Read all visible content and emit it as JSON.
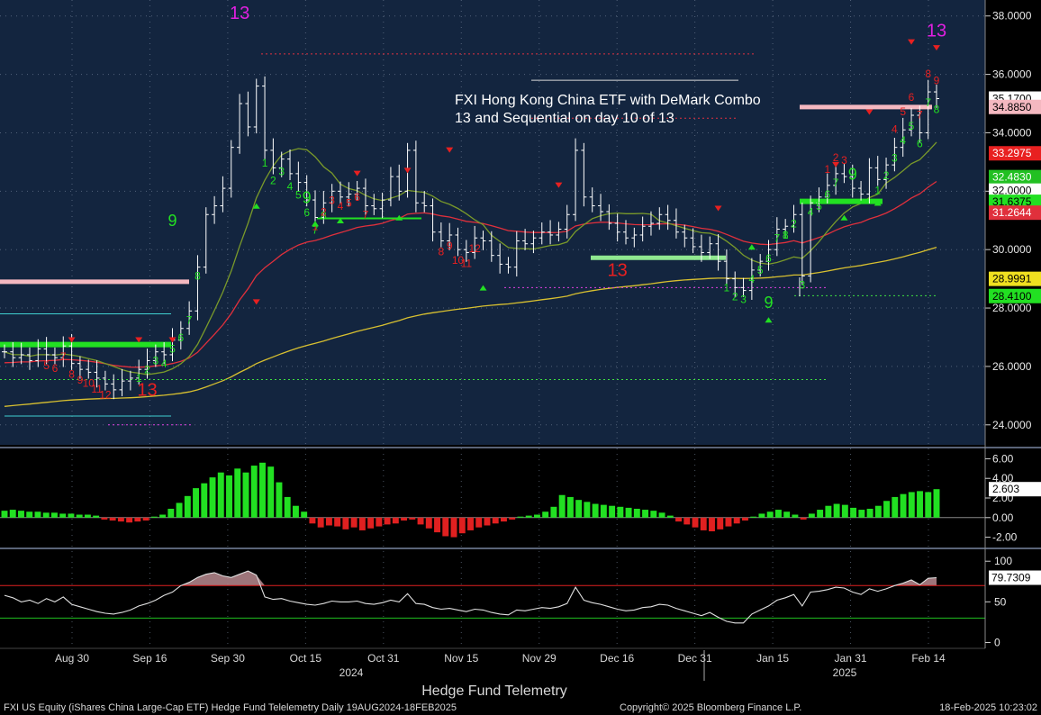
{
  "window": {
    "footer_title": "Hedge Fund Telemetry",
    "status_left": "FXI US Equity (iShares China Large-Cap ETF) Hedge Fund Telelemetry  Daily 19AUG2024-18FEB2025",
    "status_mid": "Copyright© 2025 Bloomberg Finance L.P.",
    "status_right": "18-Feb-2025 10:23:02"
  },
  "colors": {
    "price_bg": "#13253f",
    "panel_bg": "#000000",
    "ma_red": "#e0303c",
    "ma_olive": "#7a9a2a",
    "ma_yellow": "#d8c030",
    "setup_green": "#22e022",
    "countdown_red": "#e82020",
    "thirteen_magenta": "#e020e0",
    "tdst_pink": "#f4b8c0",
    "macd_pos": "#22e022",
    "macd_neg": "#e02020",
    "rsi_line": "#e0e0e0"
  },
  "chart_data": [
    {
      "type": "candlestick",
      "panel": "price",
      "title": "FXI Hong Kong China ETF with DeMark Combo 13 and Sequential on day 10 of 13",
      "annotation_lines": [
        "FXI Hong Kong China ETF with DeMark Combo",
        "13 and Sequential on day 10 of 13"
      ],
      "y_axis": {
        "ticks": [
          "24.0000",
          "26.0000",
          "28.0000",
          "30.0000",
          "32.0000",
          "34.0000",
          "36.0000",
          "38.0000"
        ],
        "ylim": [
          23.5,
          38.3
        ]
      },
      "x_axis": {
        "tick_labels": [
          "Aug 30",
          "Sep 16",
          "Sep 30",
          "Oct 15",
          "Oct 31",
          "Nov 15",
          "Nov 29",
          "Dec 16",
          "Dec 31",
          "Jan 15",
          "Jan 31",
          "Feb 14"
        ],
        "year_labels": [
          "2024",
          "2025"
        ]
      },
      "price_close_series": [
        26.5,
        26.3,
        26.4,
        26.2,
        26.6,
        26.4,
        26.3,
        26.7,
        26.1,
        25.9,
        25.8,
        25.6,
        25.4,
        25.2,
        25.5,
        25.6,
        25.9,
        26.2,
        26.5,
        26.4,
        26.9,
        27.3,
        27.9,
        29.4,
        31.2,
        31.5,
        32.1,
        33.5,
        35.0,
        34.2,
        35.6,
        33.4,
        32.8,
        33.1,
        32.6,
        32.3,
        31.7,
        31.1,
        31.6,
        32.0,
        31.8,
        31.9,
        32.1,
        31.5,
        31.4,
        31.7,
        32.5,
        32.0,
        33.4,
        31.6,
        31.5,
        30.6,
        30.3,
        30.5,
        30.0,
        29.9,
        30.4,
        30.3,
        29.8,
        29.5,
        29.4,
        30.3,
        30.2,
        30.4,
        30.6,
        30.5,
        30.7,
        31.2,
        33.4,
        31.8,
        31.5,
        31.3,
        30.9,
        30.6,
        30.4,
        30.5,
        30.8,
        30.9,
        31.2,
        31.0,
        30.6,
        30.4,
        30.1,
        29.9,
        30.2,
        29.6,
        29.0,
        28.7,
        28.6,
        29.3,
        29.6,
        30.0,
        30.7,
        30.8,
        31.2,
        29.1,
        31.6,
        31.8,
        32.2,
        32.6,
        32.5,
        32.1,
        31.9,
        32.8,
        32.4,
        32.9,
        33.5,
        34.1,
        34.6,
        34.0,
        35.4,
        35.17
      ],
      "last_price_labels": [
        {
          "value": 35.17,
          "label": "35.1700",
          "color": "#ffffff"
        },
        {
          "value": 34.885,
          "label": "34.8850",
          "color": "#f4b8c0"
        },
        {
          "value": 33.2975,
          "label": "33.2975",
          "color": "#e82020"
        },
        {
          "value": 32.483,
          "label": "32.4830",
          "color": "#22c022"
        },
        {
          "value": 32.0,
          "label": "32.0000",
          "color": "#ffffff"
        },
        {
          "value": 31.6375,
          "label": "31.6375",
          "color": "#22e022"
        },
        {
          "value": 31.2644,
          "label": "31.2644",
          "color": "#e0303c"
        },
        {
          "value": 28.9991,
          "label": "28.9991",
          "color": "#f0e020"
        },
        {
          "value": 28.41,
          "label": "28.4100",
          "color": "#22e022"
        }
      ],
      "big_13_labels": [
        {
          "text": "13",
          "x_index": 28,
          "value": 37.9
        },
        {
          "text": "13",
          "x_index": 111,
          "value": 37.3
        },
        {
          "text": "13",
          "x_index": 17,
          "value": 25.0
        },
        {
          "text": "13",
          "x_index": 73,
          "value": 29.1
        }
      ],
      "setup_9_labels": [
        {
          "text": "9",
          "x_index": 20,
          "value": 30.8
        },
        {
          "text": "9",
          "x_index": 36,
          "value": 31.6
        },
        {
          "text": "9",
          "x_index": 101,
          "value": 32.4
        },
        {
          "text": "9",
          "x_index": 91,
          "value": 28.0
        }
      ]
    },
    {
      "type": "bar",
      "panel": "histogram",
      "y_axis": {
        "ticks": [
          "6.00",
          "4.00",
          "2.00",
          "0.00",
          "-2.00"
        ],
        "ylim": [
          -2.5,
          6.5
        ]
      },
      "last_value_label": "2.603",
      "values": [
        0.7,
        0.8,
        0.7,
        0.6,
        0.6,
        0.5,
        0.5,
        0.4,
        0.4,
        0.3,
        0.3,
        0.2,
        -0.2,
        -0.3,
        -0.4,
        -0.5,
        -0.4,
        -0.3,
        0.1,
        0.3,
        0.9,
        1.5,
        2.2,
        3.0,
        3.5,
        4.1,
        4.6,
        4.3,
        5.0,
        4.6,
        5.3,
        5.6,
        5.2,
        3.6,
        2.1,
        1.2,
        0.6,
        -0.6,
        -1.0,
        -0.8,
        -0.9,
        -1.2,
        -1.0,
        -1.3,
        -1.1,
        -0.9,
        -0.7,
        -0.6,
        -0.3,
        -0.2,
        -0.7,
        -1.1,
        -1.5,
        -1.9,
        -2.0,
        -1.6,
        -1.3,
        -1.0,
        -0.8,
        -0.6,
        -0.4,
        -0.2,
        0.1,
        0.2,
        0.3,
        0.6,
        1.1,
        2.3,
        2.1,
        1.8,
        1.6,
        1.4,
        1.3,
        1.2,
        1.1,
        1.0,
        0.9,
        0.8,
        0.7,
        0.5,
        0.2,
        -0.4,
        -0.7,
        -1.0,
        -1.3,
        -1.4,
        -1.2,
        -0.9,
        -0.6,
        -0.3,
        0.1,
        0.4,
        0.6,
        0.8,
        0.6,
        0.3,
        -0.2,
        0.4,
        0.8,
        1.2,
        1.4,
        1.3,
        1.0,
        0.8,
        0.9,
        1.2,
        1.7,
        2.1,
        2.4,
        2.6,
        2.7,
        2.6,
        2.9
      ]
    },
    {
      "type": "area",
      "panel": "oscillator",
      "y_axis": {
        "ticks": [
          "100",
          "50",
          "0"
        ],
        "ylim": [
          -5,
          108
        ]
      },
      "last_value_label": "79.7309",
      "overbought": 70,
      "oversold": 30,
      "values": [
        58,
        55,
        50,
        52,
        48,
        54,
        50,
        56,
        47,
        44,
        41,
        38,
        36,
        35,
        37,
        40,
        45,
        48,
        52,
        58,
        62,
        70,
        74,
        80,
        84,
        86,
        82,
        80,
        84,
        88,
        83,
        56,
        53,
        54,
        51,
        49,
        47,
        46,
        48,
        51,
        50,
        50,
        51,
        48,
        47,
        49,
        52,
        50,
        60,
        48,
        47,
        43,
        41,
        42,
        40,
        38,
        41,
        40,
        37,
        35,
        34,
        40,
        39,
        41,
        43,
        42,
        44,
        48,
        68,
        52,
        49,
        47,
        44,
        41,
        39,
        40,
        43,
        44,
        47,
        46,
        42,
        39,
        36,
        33,
        37,
        31,
        26,
        24,
        24,
        35,
        40,
        45,
        52,
        55,
        59,
        45,
        62,
        63,
        65,
        68,
        67,
        62,
        59,
        66,
        63,
        66,
        70,
        73,
        77,
        71,
        79,
        79.7309
      ]
    }
  ]
}
